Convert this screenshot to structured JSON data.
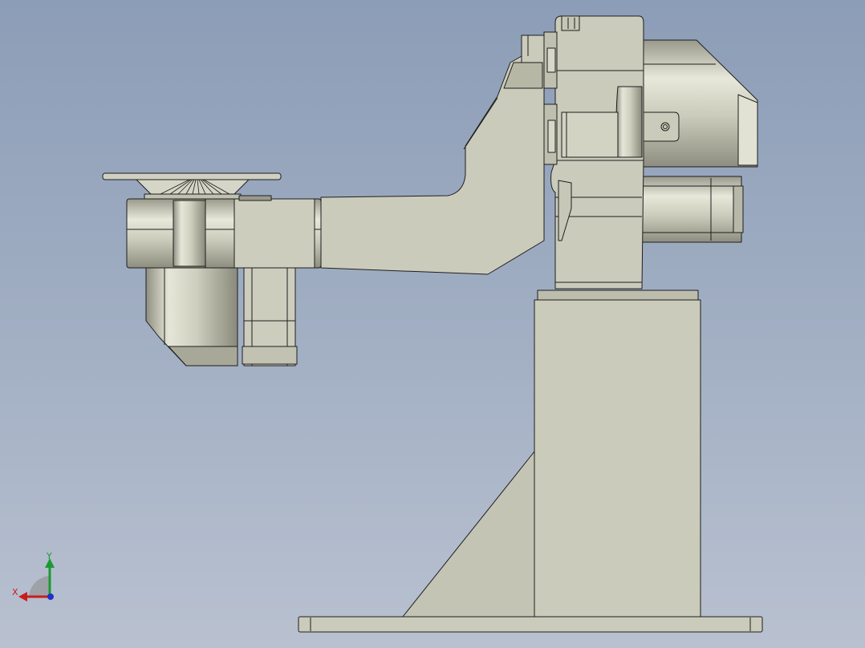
{
  "viewport": {
    "background_top": "#8c9db7",
    "background_bottom": "#b9c1d0"
  },
  "model": {
    "part_color": "#cbcbbb",
    "part_shade": "#b9b9a8",
    "edge_color": "#1e1e1e"
  },
  "triad": {
    "x_label": "X",
    "y_label": "Y",
    "x_color": "#c81e1e",
    "y_color": "#1a9a32",
    "z_color": "#2030c8",
    "icons": [
      "axis-x-arrow-icon",
      "axis-y-arrow-icon",
      "axis-z-dot-icon"
    ]
  }
}
